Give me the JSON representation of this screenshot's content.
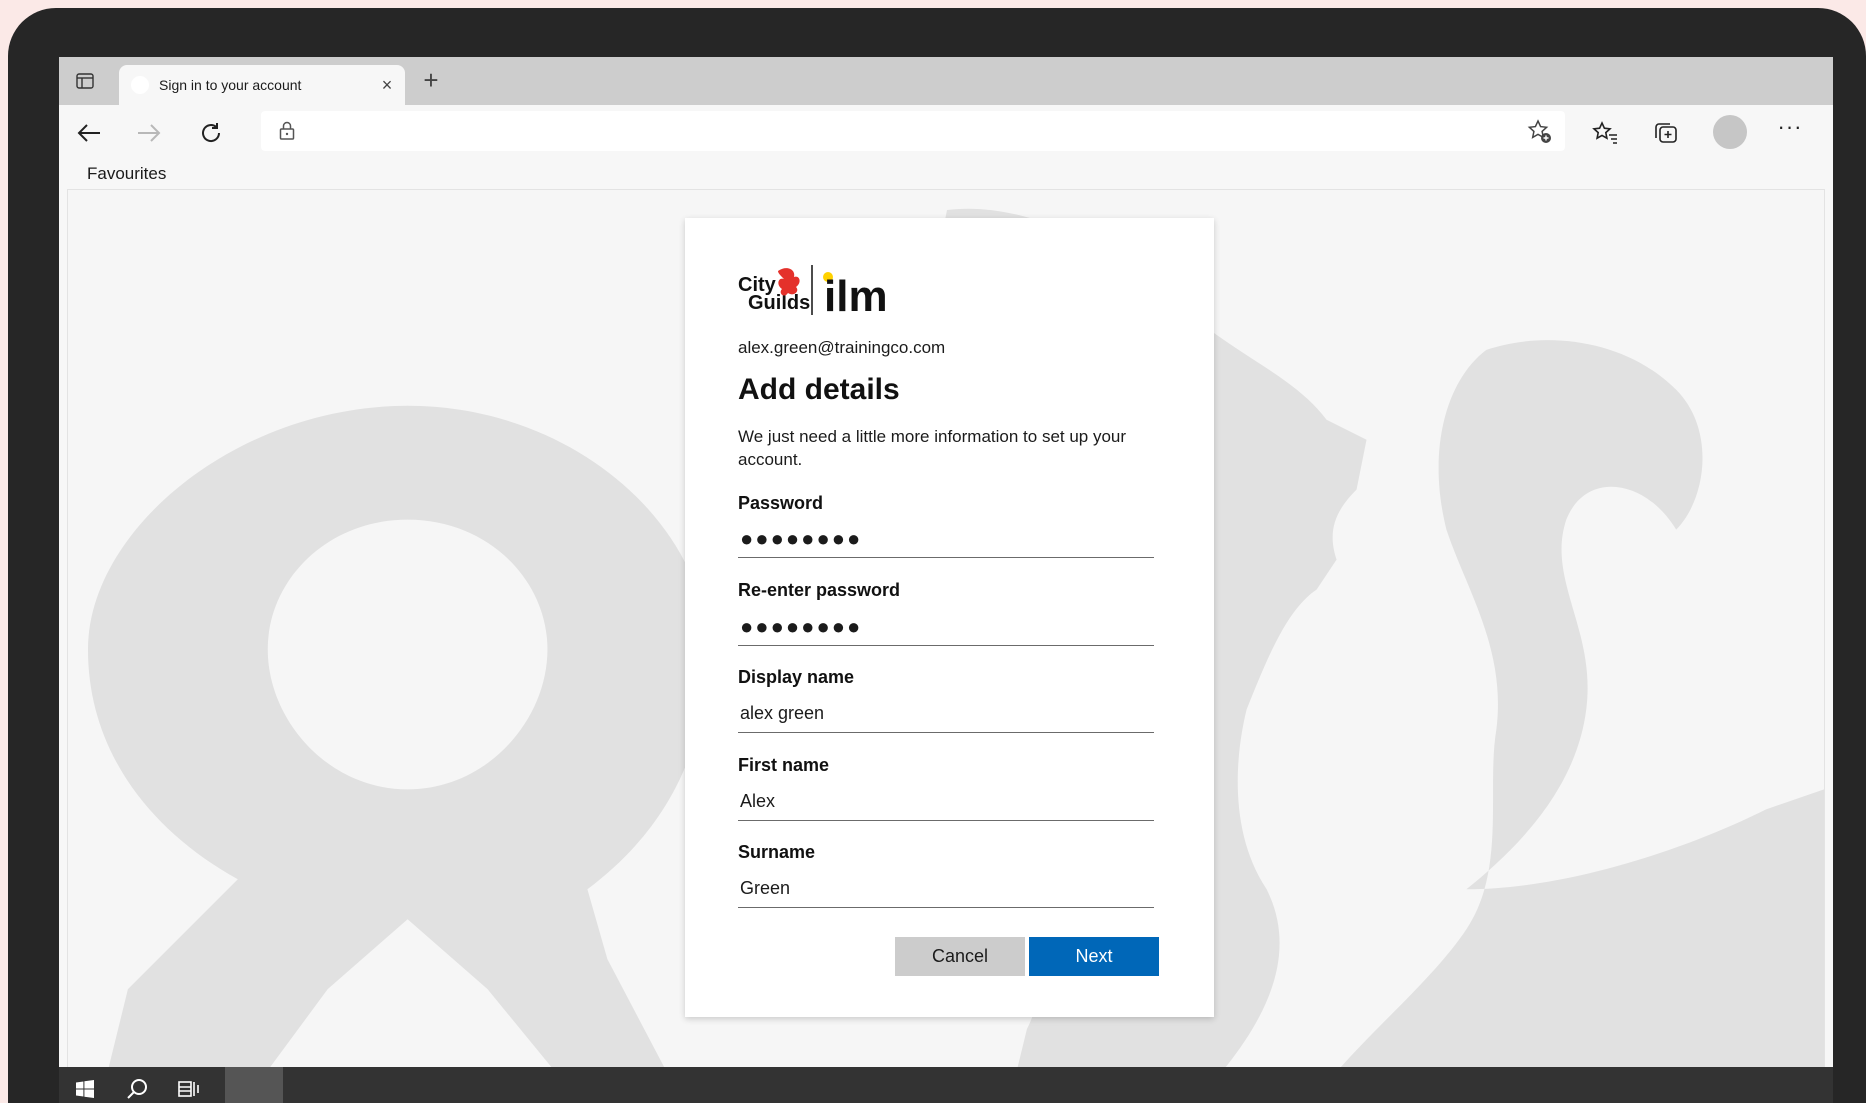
{
  "browser": {
    "tab_title": "Sign in to your account",
    "new_tab_icon": "plus-icon",
    "close_tab_icon": "close-icon",
    "favourites_label": "Favourites",
    "address": ""
  },
  "form": {
    "email": "alex.green@trainingco.com",
    "heading": "Add details",
    "description": "We just need a little more information to set up your account.",
    "fields": [
      {
        "label": "Password",
        "value": "●●●●●●●●"
      },
      {
        "label": "Re-enter password",
        "value": "●●●●●●●●"
      },
      {
        "label": "Display name",
        "value": "alex green"
      },
      {
        "label": "First name",
        "value": "Alex"
      },
      {
        "label": "Surname",
        "value": "Green"
      }
    ],
    "cancel_label": "Cancel",
    "next_label": "Next"
  },
  "logo": {
    "brand_left_line1": "City",
    "brand_left_line2": "Guilds",
    "brand_right": "ilm"
  },
  "colors": {
    "primary_button": "#0067b8",
    "secondary_button": "#cccccc",
    "logo_red": "#e4312b",
    "logo_yellow": "#ffd200"
  }
}
